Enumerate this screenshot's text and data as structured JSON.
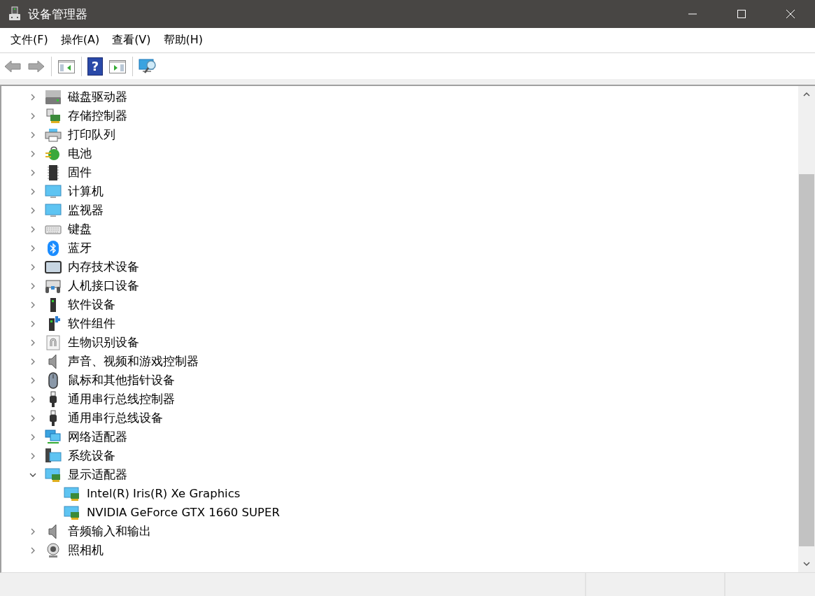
{
  "window": {
    "title": "设备管理器"
  },
  "toolbar": {
    "help_glyph": "?"
  },
  "menu": [
    "文件(F)",
    "操作(A)",
    "查看(V)",
    "帮助(H)"
  ],
  "tree": [
    {
      "label": "磁盘驱动器",
      "expanded": false
    },
    {
      "label": "存储控制器",
      "expanded": false
    },
    {
      "label": "打印队列",
      "expanded": false
    },
    {
      "label": "电池",
      "expanded": false
    },
    {
      "label": "固件",
      "expanded": false
    },
    {
      "label": "计算机",
      "expanded": false
    },
    {
      "label": "监视器",
      "expanded": false
    },
    {
      "label": "键盘",
      "expanded": false
    },
    {
      "label": "蓝牙",
      "expanded": false
    },
    {
      "label": "内存技术设备",
      "expanded": false
    },
    {
      "label": "人机接口设备",
      "expanded": false
    },
    {
      "label": "软件设备",
      "expanded": false
    },
    {
      "label": "软件组件",
      "expanded": false
    },
    {
      "label": "生物识别设备",
      "expanded": false
    },
    {
      "label": "声音、视频和游戏控制器",
      "expanded": false
    },
    {
      "label": "鼠标和其他指针设备",
      "expanded": false
    },
    {
      "label": "通用串行总线控制器",
      "expanded": false
    },
    {
      "label": "通用串行总线设备",
      "expanded": false
    },
    {
      "label": "网络适配器",
      "expanded": false
    },
    {
      "label": "系统设备",
      "expanded": false
    },
    {
      "label": "显示适配器",
      "expanded": true,
      "children": [
        {
          "label": "Intel(R) Iris(R) Xe Graphics"
        },
        {
          "label": "NVIDIA GeForce GTX 1660 SUPER"
        }
      ]
    },
    {
      "label": "音频输入和输出",
      "expanded": false
    },
    {
      "label": "照相机",
      "expanded": false
    }
  ]
}
